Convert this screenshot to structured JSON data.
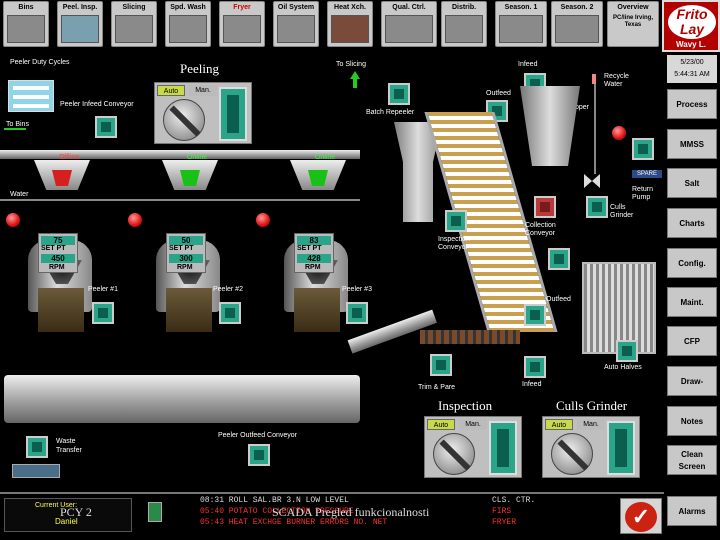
{
  "nav": [
    {
      "label": "Bins"
    },
    {
      "label": "Peel. Insp."
    },
    {
      "label": "Slicing"
    },
    {
      "label": "Spd. Wash"
    },
    {
      "label": "Fryer"
    },
    {
      "label": "Oil System"
    },
    {
      "label": "Heat Xch."
    },
    {
      "label": "Qual. Ctrl."
    },
    {
      "label": "Distrib."
    },
    {
      "label": "Season. 1"
    },
    {
      "label": "Season. 2"
    },
    {
      "label": "Overview",
      "sub": "PC/line Irving, Texas"
    }
  ],
  "logo": {
    "line1": "Frito",
    "line2": "Lay",
    "sub": "Wavy L."
  },
  "datetime": {
    "date": "5/23/00",
    "time": "5:44:31 AM"
  },
  "side_buttons": [
    "Process",
    "MMSS",
    "Salt",
    "Charts",
    "Config.",
    "Maint.",
    "CFP",
    "Draw-",
    "Notes",
    "Clean Screen",
    "Alarms"
  ],
  "labels": {
    "peeler_duty": "Peeler Duty Cycles",
    "peeling": "Peeling",
    "peeler_infeed": "Peeler Infeed Conveyor",
    "to_bins": "To Bins",
    "to_slicing": "To Slicing",
    "infeed": "Infeed",
    "outfeed": "Outfeed",
    "hopper": "Hopper",
    "recycle_water": "Recycle Water",
    "batch_repeeler": "Batch Repeeler",
    "water": "Water",
    "spare": "SPARE",
    "return_pump": "Return Pump",
    "culls_grinder_small": "Culls Grinder",
    "collection_conveyor": "Collection Conveyor",
    "inspection_conveyor": "Inspection Conveyor",
    "outfeed2": "Outfeed",
    "auto_halves": "Auto Halves",
    "trim_pare": "Trim & Pare",
    "infeed2": "Infeed",
    "inspection": "Inspection",
    "culls_grinder": "Culls Grinder",
    "waste_transfer": "Waste Transfer",
    "peeler_outfeed": "Peeler Outfeed Conveyor",
    "auto": "Auto",
    "man": "Man."
  },
  "peelers": [
    {
      "status": "Offline",
      "color": "#d62020",
      "label": "Peeler #1",
      "val1": "75",
      "setpt": "SET PT",
      "val2": "450",
      "rpm": "RPM"
    },
    {
      "status": "Online",
      "color": "#18c018",
      "label": "Peeler #2",
      "val1": "50",
      "setpt": "SET PT",
      "val2": "300",
      "rpm": "RPM"
    },
    {
      "status": "Online",
      "color": "#18c018",
      "label": "Peeler #3",
      "val1": "83",
      "setpt": "SET PT",
      "val2": "428",
      "rpm": "RPM"
    }
  ],
  "alarm": {
    "user_title": "Current User:",
    "user": "Daniel",
    "rows": [
      {
        "text": "08:31 ROLL SAL.BR 3.N LOW LEVEL",
        "status": "CLS. CTR.",
        "color": "#dddddd"
      },
      {
        "text": "05:40 POTATO COLLECTION PRESSURE",
        "status": "FIRS",
        "color": "#ff3030"
      },
      {
        "text": "05:43 HEAT EXCHGE BURNER ERRORS NO. NET",
        "status": "FRYER",
        "color": "#ff3030"
      }
    ]
  },
  "overlay": {
    "left": "PCY 2",
    "center": "SCADA Pregled funkcionalnosti"
  }
}
